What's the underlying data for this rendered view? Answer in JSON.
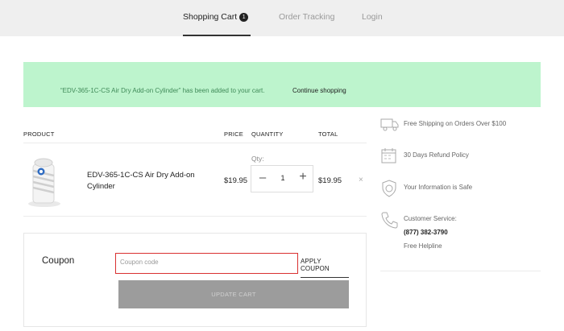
{
  "nav": {
    "tabs": [
      {
        "label": "Shopping Cart",
        "badge": "1"
      },
      {
        "label": "Order Tracking"
      },
      {
        "label": "Login"
      }
    ]
  },
  "notice": {
    "message": "“EDV-365-1C-CS Air Dry Add-on Cylinder” has been added to your cart.",
    "link": "Continue shopping"
  },
  "table": {
    "headers": {
      "product": "PRODUCT",
      "price": "PRICE",
      "quantity": "QUANTITY",
      "total": "TOTAL"
    },
    "rows": [
      {
        "name": "EDV-365-1C-CS Air Dry Add-on Cylinder",
        "price": "$19.95",
        "qty_label": "Qty:",
        "qty": "1",
        "total": "$19.95",
        "remove": "×"
      }
    ]
  },
  "coupon": {
    "title": "Coupon",
    "placeholder": "Coupon code",
    "apply_label": "APPLY COUPON",
    "update_label": "UPDATE CART"
  },
  "info": {
    "shipping": "Free Shipping on Orders Over $100",
    "refund": "30 Days Refund Policy",
    "safe": "Your Information is Safe",
    "service_label": "Customer Service:",
    "phone": "(877) 382-3790",
    "helpline": "Free Helpline"
  },
  "colors": {
    "notice_bg": "#bdf4cd",
    "notice_text": "#3f8a58",
    "coupon_border_focus": "#d93030",
    "update_button_bg": "#9c9c9c"
  }
}
